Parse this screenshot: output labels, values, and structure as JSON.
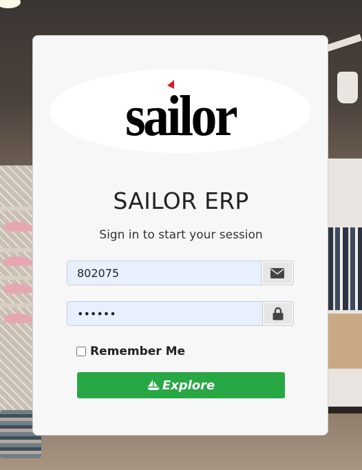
{
  "brand": {
    "logo_text": "sailor",
    "accent_color": "#d32027"
  },
  "login": {
    "title": "SAILOR ERP",
    "subtitle": "Sign in to start your session",
    "username": {
      "value": "802075",
      "icon": "envelope-icon"
    },
    "password": {
      "value": "••••••",
      "icon": "lock-icon"
    },
    "remember_label": "Remember Me",
    "remember_checked": false,
    "submit_label": "Explore",
    "submit_icon": "sailboat-icon",
    "submit_color": "#28a745"
  }
}
